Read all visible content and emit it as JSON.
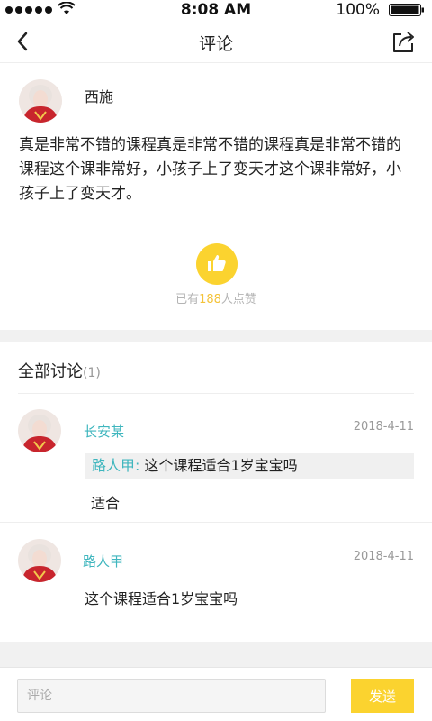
{
  "status_bar": {
    "time": "8:08 AM",
    "battery": "100%"
  },
  "nav": {
    "title": "评论",
    "back_icon": "chevron-left-icon",
    "share_icon": "share-icon"
  },
  "main_comment": {
    "author": "西施",
    "body": "真是非常不错的课程真是非常不错的课程真是非常不错的课程这个课非常好，小孩子上了变天才这个课非常好，小孩子上了变天才。",
    "like_prefix": "已有",
    "like_count": "188",
    "like_suffix": "人点赞"
  },
  "discussion": {
    "title": "全部讨论",
    "count": "(1)",
    "replies": [
      {
        "name": "长安某",
        "date": "2018-4-11",
        "quote_author": "路人甲:",
        "quote_text": " 这个课程适合1岁宝宝吗",
        "text": "适合"
      },
      {
        "name": "路人甲",
        "date": "2018-4-11",
        "text": "这个课程适合1岁宝宝吗"
      }
    ]
  },
  "input": {
    "placeholder": "评论",
    "send_label": "发送"
  },
  "colors": {
    "accent_yellow": "#fbd32f",
    "name_teal": "#3fb6be",
    "like_number": "#f4c33a"
  }
}
